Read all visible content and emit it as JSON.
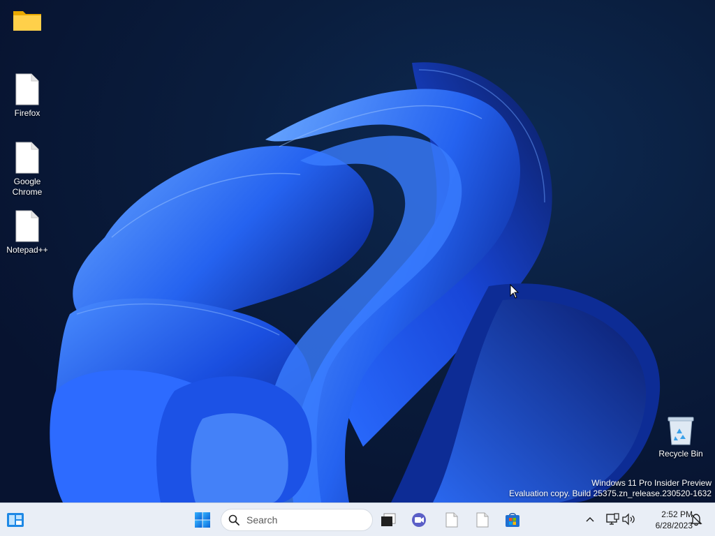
{
  "desktop": {
    "icons": [
      {
        "label": "",
        "icon": "folder-icon"
      },
      {
        "label": "Firefox",
        "icon": "file-icon"
      },
      {
        "label": "Google Chrome",
        "icon": "file-icon"
      },
      {
        "label": "Notepad++",
        "icon": "file-icon"
      },
      {
        "label": "Recycle Bin",
        "icon": "recycle-bin-icon"
      }
    ],
    "watermark": {
      "line1": "Windows 11 Pro Insider Preview",
      "line2": "Evaluation copy. Build 25375.zn_release.230520-1632"
    }
  },
  "taskbar": {
    "widgets_icon": "widgets-icon",
    "start_icon": "windows-start-icon",
    "search": {
      "placeholder": "Search",
      "value": ""
    },
    "apps": [
      {
        "name": "task-view",
        "icon": "task-view-icon"
      },
      {
        "name": "meet",
        "icon": "video-camera-icon"
      },
      {
        "name": "file-1",
        "icon": "file-icon"
      },
      {
        "name": "file-2",
        "icon": "file-icon"
      },
      {
        "name": "store",
        "icon": "store-icon"
      }
    ],
    "tray": {
      "chevron": "chevron-up-icon",
      "network": "network-icon",
      "volume": "speaker-icon",
      "notification": "notification-bell-icon"
    },
    "clock": {
      "time": "2:52 PM",
      "date": "6/28/2023"
    }
  },
  "colors": {
    "accent": "#0067c0",
    "wallpaper_bg": "#0a1d3d",
    "bloom": "#1a4fe0",
    "taskbar_bg": "#e9eef6"
  }
}
